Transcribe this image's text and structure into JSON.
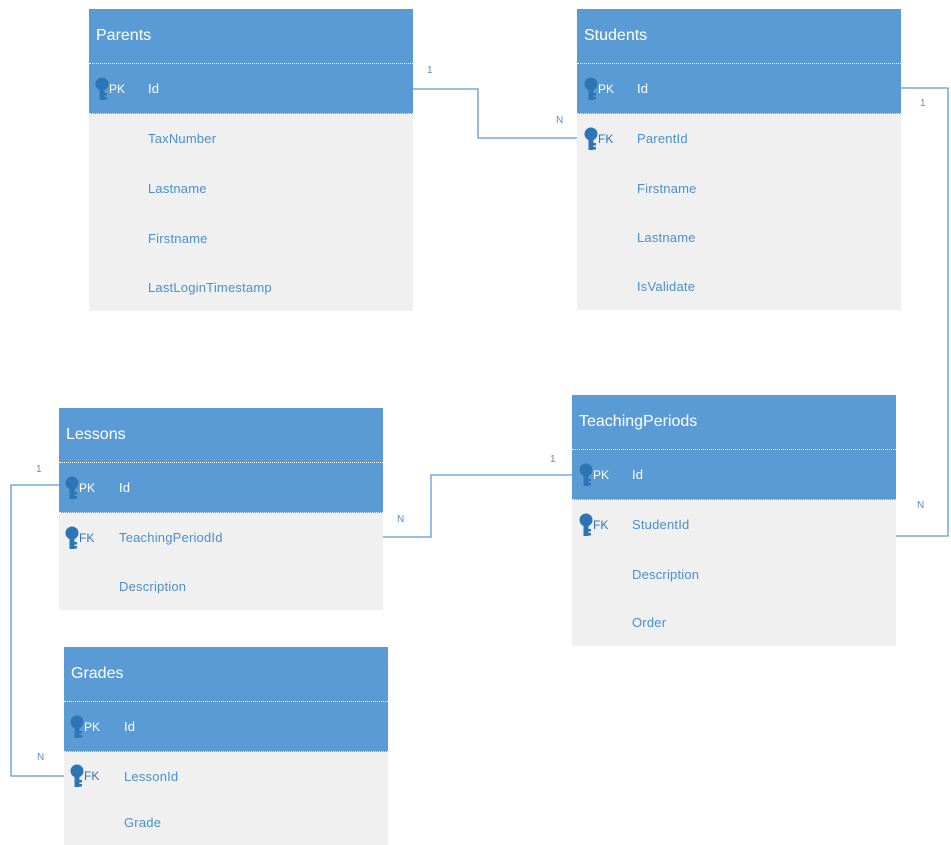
{
  "colors": {
    "header": "#5b9bd5",
    "body": "#f0f0f0",
    "field_text": "#4a8fd0",
    "key_icon": "#2e75b6",
    "connector": "#5b9bd5"
  },
  "entities": {
    "parents": {
      "title": "Parents",
      "pk": {
        "tag": "PK",
        "name": "Id"
      },
      "fields": [
        "TaxNumber",
        "Lastname",
        "Firstname",
        "LastLoginTimestamp"
      ]
    },
    "students": {
      "title": "Students",
      "pk": {
        "tag": "PK",
        "name": "Id"
      },
      "fk": {
        "tag": "FK",
        "name": "ParentId"
      },
      "fields": [
        "Firstname",
        "Lastname",
        "IsValidate"
      ]
    },
    "lessons": {
      "title": "Lessons",
      "pk": {
        "tag": "PK",
        "name": "Id"
      },
      "fk": {
        "tag": "FK",
        "name": "TeachingPeriodId"
      },
      "fields": [
        "Description"
      ]
    },
    "teaching_periods": {
      "title": "TeachingPeriods",
      "pk": {
        "tag": "PK",
        "name": "Id"
      },
      "fk": {
        "tag": "FK",
        "name": "StudentId"
      },
      "fields": [
        "Description",
        "Order"
      ]
    },
    "grades": {
      "title": "Grades",
      "pk": {
        "tag": "PK",
        "name": "Id"
      },
      "fk": {
        "tag": "FK",
        "name": "LessonId"
      },
      "fields": [
        "Grade"
      ]
    }
  },
  "relationships": [
    {
      "from": "Parents",
      "to": "Students",
      "one": "1",
      "many": "N"
    },
    {
      "from": "Students",
      "to": "TeachingPeriods",
      "one": "1",
      "many": "N"
    },
    {
      "from": "TeachingPeriods",
      "to": "Lessons",
      "one": "1",
      "many": "N"
    },
    {
      "from": "Lessons",
      "to": "Grades",
      "one": "1",
      "many": "N"
    }
  ]
}
